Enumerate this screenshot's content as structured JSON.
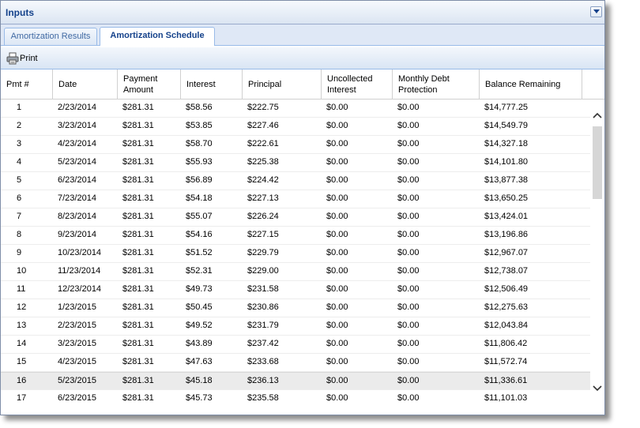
{
  "panel": {
    "title": "Inputs"
  },
  "tabs": [
    {
      "label": "Amortization Results",
      "active": false
    },
    {
      "label": "Amortization Schedule",
      "active": true
    }
  ],
  "toolbar": {
    "print_label": "Print"
  },
  "columns": [
    {
      "label": "Pmt #"
    },
    {
      "label": "Date"
    },
    {
      "label": "Payment Amount"
    },
    {
      "label": "Interest"
    },
    {
      "label": "Principal"
    },
    {
      "label": "Uncollected Interest"
    },
    {
      "label": "Monthly Debt Protection"
    },
    {
      "label": "Balance Remaining"
    }
  ],
  "rows": [
    [
      "1",
      "2/23/2014",
      "$281.31",
      "$58.56",
      "$222.75",
      "$0.00",
      "$0.00",
      "$14,777.25"
    ],
    [
      "2",
      "3/23/2014",
      "$281.31",
      "$53.85",
      "$227.46",
      "$0.00",
      "$0.00",
      "$14,549.79"
    ],
    [
      "3",
      "4/23/2014",
      "$281.31",
      "$58.70",
      "$222.61",
      "$0.00",
      "$0.00",
      "$14,327.18"
    ],
    [
      "4",
      "5/23/2014",
      "$281.31",
      "$55.93",
      "$225.38",
      "$0.00",
      "$0.00",
      "$14,101.80"
    ],
    [
      "5",
      "6/23/2014",
      "$281.31",
      "$56.89",
      "$224.42",
      "$0.00",
      "$0.00",
      "$13,877.38"
    ],
    [
      "6",
      "7/23/2014",
      "$281.31",
      "$54.18",
      "$227.13",
      "$0.00",
      "$0.00",
      "$13,650.25"
    ],
    [
      "7",
      "8/23/2014",
      "$281.31",
      "$55.07",
      "$226.24",
      "$0.00",
      "$0.00",
      "$13,424.01"
    ],
    [
      "8",
      "9/23/2014",
      "$281.31",
      "$54.16",
      "$227.15",
      "$0.00",
      "$0.00",
      "$13,196.86"
    ],
    [
      "9",
      "10/23/2014",
      "$281.31",
      "$51.52",
      "$229.79",
      "$0.00",
      "$0.00",
      "$12,967.07"
    ],
    [
      "10",
      "11/23/2014",
      "$281.31",
      "$52.31",
      "$229.00",
      "$0.00",
      "$0.00",
      "$12,738.07"
    ],
    [
      "11",
      "12/23/2014",
      "$281.31",
      "$49.73",
      "$231.58",
      "$0.00",
      "$0.00",
      "$12,506.49"
    ],
    [
      "12",
      "1/23/2015",
      "$281.31",
      "$50.45",
      "$230.86",
      "$0.00",
      "$0.00",
      "$12,275.63"
    ],
    [
      "13",
      "2/23/2015",
      "$281.31",
      "$49.52",
      "$231.79",
      "$0.00",
      "$0.00",
      "$12,043.84"
    ],
    [
      "14",
      "3/23/2015",
      "$281.31",
      "$43.89",
      "$237.42",
      "$0.00",
      "$0.00",
      "$11,806.42"
    ],
    [
      "15",
      "4/23/2015",
      "$281.31",
      "$47.63",
      "$233.68",
      "$0.00",
      "$0.00",
      "$11,572.74"
    ],
    [
      "16",
      "5/23/2015",
      "$281.31",
      "$45.18",
      "$236.13",
      "$0.00",
      "$0.00",
      "$11,336.61"
    ],
    [
      "17",
      "6/23/2015",
      "$281.31",
      "$45.73",
      "$235.58",
      "$0.00",
      "$0.00",
      "$11,101.03"
    ]
  ],
  "selected_row": 16,
  "colors": {
    "header_text": "#15428b",
    "tab_border": "#99bbe8",
    "selected_row": "#ebebeb"
  }
}
